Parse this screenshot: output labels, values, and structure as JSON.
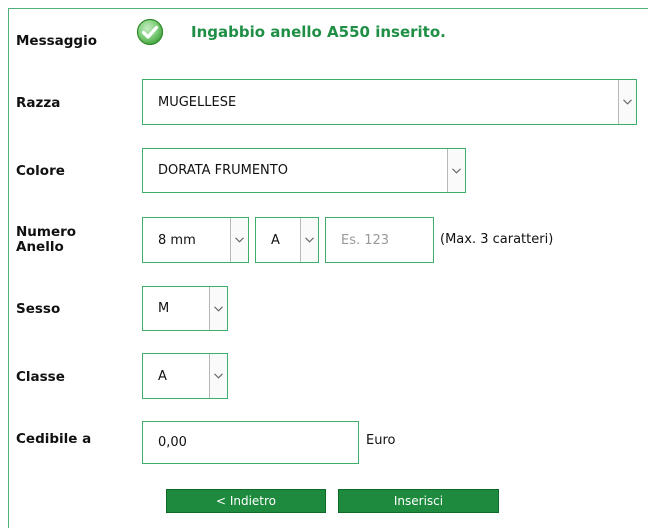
{
  "message": {
    "label": "Messaggio",
    "icon": "check-circle-icon",
    "text": "Ingabbio anello A550 inserito."
  },
  "razza": {
    "label": "Razza",
    "value": "MUGELLESE"
  },
  "colore": {
    "label": "Colore",
    "value": "DORATA FRUMENTO"
  },
  "numero_anello": {
    "label_line1": "Numero",
    "label_line2": "Anello",
    "size_value": "8 mm",
    "series_value": "A",
    "number_placeholder": "Es. 123",
    "number_value": "",
    "hint": "(Max. 3 caratteri)"
  },
  "sesso": {
    "label": "Sesso",
    "value": "M"
  },
  "classe": {
    "label": "Classe",
    "value": "A"
  },
  "cedibile": {
    "label": "Cedibile a",
    "value": "0,00",
    "unit": "Euro"
  },
  "buttons": {
    "back": "< Indietro",
    "submit": "Inserisci"
  },
  "colors": {
    "accent": "#3fae6a",
    "button": "#1d8a3e",
    "message": "#1f8f45"
  }
}
